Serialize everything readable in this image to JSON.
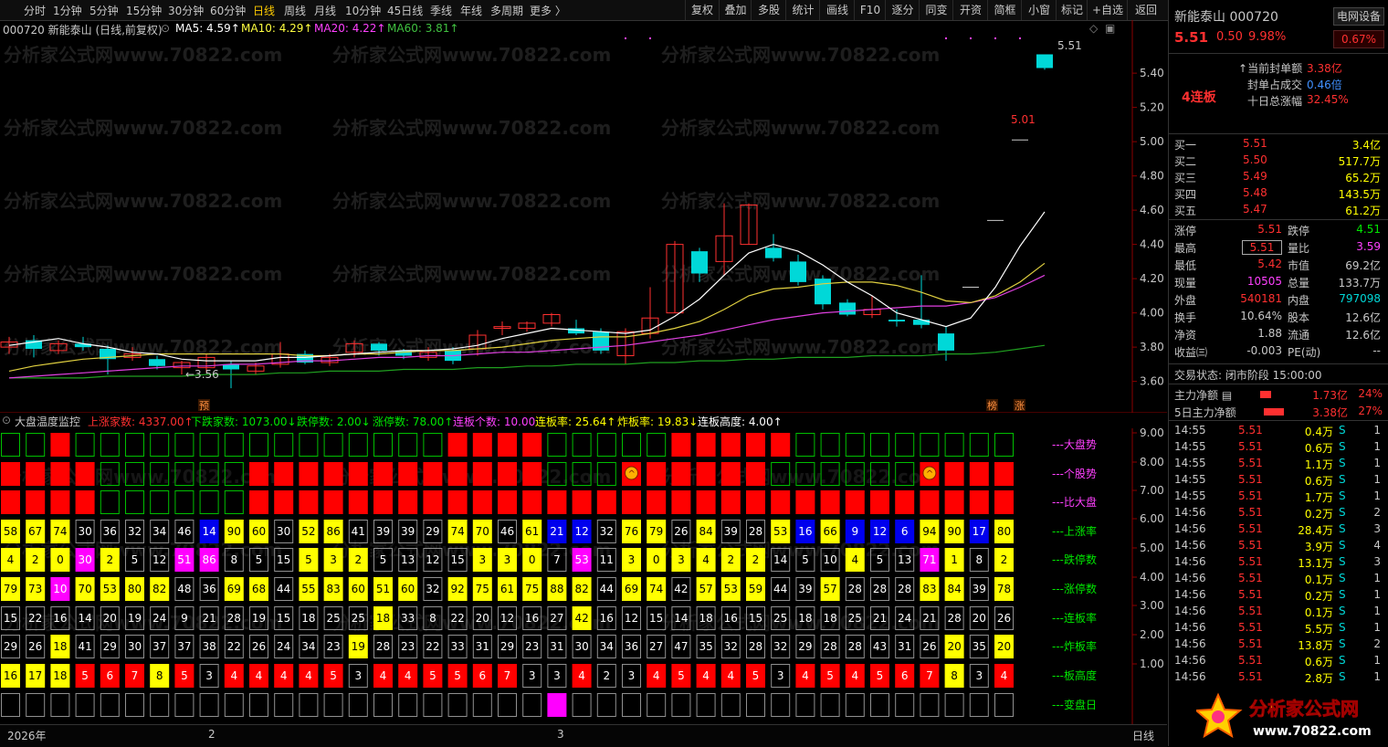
{
  "toolbar": {
    "periods": [
      "分时",
      "1分钟",
      "5分钟",
      "15分钟",
      "30分钟",
      "60分钟",
      "日线",
      "周线",
      "月线",
      "10分钟",
      "45日线",
      "季线",
      "年线",
      "多周期",
      "更多 〉"
    ],
    "active": "日线",
    "right_tools": [
      "复权",
      "叠加",
      "多股",
      "统计",
      "画线",
      "F10",
      "逐分",
      "同变",
      "开资",
      "简框",
      "小窗",
      "标记",
      "+自选",
      "返回"
    ]
  },
  "main_header": {
    "stock_label": "000720 新能泰山 (日线,前复权)",
    "ma5": "MA5: 4.59↑",
    "ma10": "MA10: 4.29↑",
    "ma20": "MA20: 4.22↑",
    "ma60": "MA60: 3.81↑"
  },
  "price_axis": [
    "5.40",
    "5.20",
    "5.00",
    "4.80",
    "4.60",
    "4.40",
    "4.20",
    "4.00",
    "3.80",
    "3.60"
  ],
  "annotations": {
    "high_label": "5.51",
    "mid_label": "5.01",
    "low_label": "3.56",
    "marker_yu": "预",
    "marker_bang": "榜",
    "marker_zhang": "涨"
  },
  "watermark": "分析家公式网www.70822.com",
  "sub_header": {
    "title": "大盘温度监控",
    "up": "上涨家数: 4337.00↑",
    "down": "下跌家数: 1073.00↓",
    "limit_down": "跌停数: 2.00↓",
    "limit_up": "涨停数: 78.00↑",
    "consec": "连板个数: 10.00",
    "consec_rate": "连板率: 25.64↑",
    "blow_rate": "炸板率: 19.83↓",
    "consec_height": "连板高度: 4.00↑"
  },
  "sub_axis": [
    "9.00",
    "8.00",
    "7.00",
    "6.00",
    "5.00",
    "4.00",
    "3.00",
    "2.00",
    "1.00"
  ],
  "row_labels": [
    "---大盘势",
    "---个股势",
    "---比大盘",
    "---上涨率",
    "---跌停数",
    "---涨停数",
    "---连板率",
    "---炸板率",
    "---板高度",
    "---变盘日"
  ],
  "grid": {
    "dapan": "GGRGGGGGGGGGGGGGGGRRRRGGGGGRRRRRGGGGGGGGG",
    "gegu": "RRRRGGGGGGRRRRRRRRRRRRGGGURRRRRGGGGGGURRR",
    "bidapan": "RRRRGGGGGGRRRRRRRRRRRRRRRRRRRRRRRRRRRRRRR",
    "shangzhang": {
      "v": [
        "58",
        "67",
        "74",
        "30",
        "36",
        "32",
        "34",
        "46",
        "14",
        "90",
        "60",
        "30",
        "52",
        "86",
        "41",
        "39",
        "39",
        "29",
        "74",
        "70",
        "46",
        "61",
        "21",
        "12",
        "32",
        "76",
        "79",
        "26",
        "84",
        "39",
        "28",
        "53",
        "16",
        "66",
        "9",
        "12",
        "6",
        "94",
        "90",
        "17",
        "80"
      ],
      "c": "YYYKKKKKBYYKYYKKKKYYKYBBKYYKYKKYBYBBBYYBY"
    },
    "dieting": {
      "v": [
        "4",
        "2",
        "0",
        "30",
        "2",
        "5",
        "12",
        "51",
        "86",
        "8",
        "5",
        "15",
        "5",
        "3",
        "2",
        "5",
        "13",
        "12",
        "15",
        "3",
        "3",
        "0",
        "7",
        "53",
        "11",
        "3",
        "0",
        "3",
        "4",
        "2",
        "2",
        "14",
        "5",
        "10",
        "4",
        "5",
        "13",
        "71",
        "1",
        "8",
        "2"
      ],
      "c": "YYYMYKKMMKKKYYYKKKKYYYKMKYYYYYYKKKYKKMYKY"
    },
    "zhangting": {
      "v": [
        "79",
        "73",
        "10",
        "70",
        "53",
        "80",
        "82",
        "48",
        "36",
        "69",
        "68",
        "44",
        "55",
        "83",
        "60",
        "51",
        "60",
        "32",
        "92",
        "75",
        "61",
        "75",
        "88",
        "82",
        "44",
        "69",
        "74",
        "42",
        "57",
        "53",
        "59",
        "44",
        "39",
        "57",
        "28",
        "28",
        "28",
        "83",
        "84",
        "39",
        "78"
      ],
      "c": "YYMYYYYKKYYKYYYYYKYYYYYYKYYKYYYKKYKKKYYKY"
    },
    "lianban": {
      "v": [
        "15",
        "22",
        "16",
        "14",
        "20",
        "19",
        "24",
        "9",
        "21",
        "28",
        "19",
        "15",
        "18",
        "25",
        "25",
        "18",
        "33",
        "8",
        "22",
        "20",
        "12",
        "16",
        "27",
        "42",
        "16",
        "12",
        "15",
        "14",
        "18",
        "16",
        "15",
        "25",
        "18",
        "18",
        "25",
        "21",
        "24",
        "21",
        "28",
        "20",
        "26"
      ],
      "c": "KKKKKKKKKKKKKKKYKKKKKKKYKKKKKKKKKKKKKKKKK"
    },
    "zhaban": {
      "v": [
        "29",
        "26",
        "18",
        "41",
        "29",
        "30",
        "37",
        "37",
        "38",
        "22",
        "26",
        "24",
        "34",
        "23",
        "19",
        "28",
        "23",
        "22",
        "33",
        "31",
        "29",
        "23",
        "31",
        "30",
        "34",
        "36",
        "27",
        "47",
        "35",
        "32",
        "28",
        "32",
        "29",
        "28",
        "28",
        "43",
        "31",
        "26",
        "20",
        "35",
        "20"
      ],
      "c": "KKYKKKKKKKKKKKYKKKKKKKKKKKKKKKKKKKKKKKYKY"
    },
    "banggao": {
      "v": [
        "16",
        "17",
        "18",
        "5",
        "6",
        "7",
        "8",
        "5",
        "3",
        "4",
        "4",
        "4",
        "4",
        "5",
        "3",
        "4",
        "4",
        "5",
        "5",
        "6",
        "7",
        "3",
        "3",
        "4",
        "2",
        "3",
        "4",
        "5",
        "4",
        "4",
        "5",
        "3",
        "4",
        "5",
        "4",
        "5",
        "6",
        "7",
        "8",
        "3",
        "4"
      ],
      "c": "YYYRRRYRKRRRRRKRRRRRRKKRKKRRRRRKRRRRRRYKR"
    },
    "biandan": "KKKKKKKKKKKKKKKKKKKKKKMKKKKKKKKKKKKKKKKKK"
  },
  "bottom": {
    "year": "2026年",
    "month2": "2",
    "month3": "3",
    "period": "日线"
  },
  "quote": {
    "name": "新能泰山",
    "code": "000720",
    "device": "电网设备",
    "price": "5.51",
    "chg": "0.50",
    "pct": "9.98%",
    "sector_pct": "0.67%",
    "streak": "4连板",
    "seal_amount_label": "当前封单额",
    "seal_amount": "3.38亿",
    "seal_ratio_label": "封单占成交",
    "seal_ratio": "0.46倍",
    "ten_day_label": "十日总涨幅",
    "ten_day": "32.45%"
  },
  "bids": [
    {
      "label": "买一",
      "price": "5.51",
      "vol": "3.4亿"
    },
    {
      "label": "买二",
      "price": "5.50",
      "vol": "517.7万"
    },
    {
      "label": "买三",
      "price": "5.49",
      "vol": "65.2万"
    },
    {
      "label": "买四",
      "price": "5.48",
      "vol": "143.5万"
    },
    {
      "label": "买五",
      "price": "5.47",
      "vol": "61.2万"
    }
  ],
  "stats": [
    [
      "涨停",
      "5.51",
      "跌停",
      "4.51"
    ],
    [
      "最高",
      "5.51",
      "量比",
      "3.59"
    ],
    [
      "最低",
      "5.42",
      "市值",
      "69.2亿"
    ],
    [
      "现量",
      "10505",
      "总量",
      "133.7万"
    ],
    [
      "外盘",
      "540181",
      "内盘",
      "797098"
    ],
    [
      "换手",
      "10.64%",
      "股本",
      "12.6亿"
    ],
    [
      "净资",
      "1.88",
      "流通",
      "12.6亿"
    ],
    [
      "收益㈢",
      "-0.003",
      "PE(动)",
      "--"
    ]
  ],
  "trade_state": "交易状态: 闭市阶段 15:00:00",
  "flows": [
    {
      "label": "主力净额",
      "val": "1.73亿",
      "pct": "24%"
    },
    {
      "label": "5日主力净额",
      "val": "3.38亿",
      "pct": "27%"
    }
  ],
  "ticks": [
    [
      "14:55",
      "5.51",
      "0.4万",
      "S",
      "1"
    ],
    [
      "14:55",
      "5.51",
      "0.6万",
      "S",
      "1"
    ],
    [
      "14:55",
      "5.51",
      "1.1万",
      "S",
      "1"
    ],
    [
      "14:55",
      "5.51",
      "0.6万",
      "S",
      "1"
    ],
    [
      "14:55",
      "5.51",
      "1.7万",
      "S",
      "1"
    ],
    [
      "14:56",
      "5.51",
      "0.2万",
      "S",
      "2"
    ],
    [
      "14:56",
      "5.51",
      "28.4万",
      "S",
      "3"
    ],
    [
      "14:56",
      "5.51",
      "3.9万",
      "S",
      "4"
    ],
    [
      "14:56",
      "5.51",
      "13.1万",
      "S",
      "3"
    ],
    [
      "14:56",
      "5.51",
      "0.1万",
      "S",
      "1"
    ],
    [
      "14:56",
      "5.51",
      "0.2万",
      "S",
      "1"
    ],
    [
      "14:56",
      "5.51",
      "0.1万",
      "S",
      "1"
    ],
    [
      "14:56",
      "5.51",
      "5.5万",
      "S",
      "1"
    ],
    [
      "14:56",
      "5.51",
      "13.8万",
      "S",
      "2"
    ],
    [
      "14:56",
      "5.51",
      "0.6万",
      "S",
      "1"
    ],
    [
      "14:56",
      "5.51",
      "2.8万",
      "S",
      "1"
    ]
  ],
  "logo": {
    "text": "分析家公式网",
    "url": "www.70822.com"
  },
  "colors": {
    "up": "#ff3030",
    "down": "#00d8d8",
    "grid_green": "#00c000",
    "cell_red": "#ff0000",
    "cell_yellow": "#ffff00",
    "cell_magenta": "#ff00ff",
    "cell_blue": "#0000ee"
  },
  "candles": [
    {
      "o": 3.8,
      "c": 3.83,
      "h": 3.86,
      "l": 3.76
    },
    {
      "o": 3.84,
      "c": 3.79,
      "h": 3.87,
      "l": 3.74
    },
    {
      "o": 3.78,
      "c": 3.82,
      "h": 3.84,
      "l": 3.76
    },
    {
      "o": 3.82,
      "c": 3.8,
      "h": 3.86,
      "l": 3.78
    },
    {
      "o": 3.79,
      "c": 3.73,
      "h": 3.81,
      "l": 3.64
    },
    {
      "o": 3.74,
      "c": 3.76,
      "h": 3.8,
      "l": 3.72
    },
    {
      "o": 3.73,
      "c": 3.69,
      "h": 3.75,
      "l": 3.67
    },
    {
      "o": 3.68,
      "c": 3.71,
      "h": 3.72,
      "l": 3.64
    },
    {
      "o": 3.68,
      "c": 3.74,
      "h": 3.76,
      "l": 3.65
    },
    {
      "o": 3.7,
      "c": 3.67,
      "h": 3.72,
      "l": 3.56
    },
    {
      "o": 3.66,
      "c": 3.69,
      "h": 3.71,
      "l": 3.64
    },
    {
      "o": 3.7,
      "c": 3.76,
      "h": 3.83,
      "l": 3.68
    },
    {
      "o": 3.76,
      "c": 3.71,
      "h": 3.78,
      "l": 3.7
    },
    {
      "o": 3.71,
      "c": 3.74,
      "h": 3.76,
      "l": 3.69
    },
    {
      "o": 3.77,
      "c": 3.82,
      "h": 3.84,
      "l": 3.74
    },
    {
      "o": 3.82,
      "c": 3.78,
      "h": 3.83,
      "l": 3.75
    },
    {
      "o": 3.78,
      "c": 3.75,
      "h": 3.79,
      "l": 3.73
    },
    {
      "o": 3.74,
      "c": 3.77,
      "h": 3.8,
      "l": 3.72
    },
    {
      "o": 3.78,
      "c": 3.72,
      "h": 3.8,
      "l": 3.7
    },
    {
      "o": 3.79,
      "c": 3.87,
      "h": 3.9,
      "l": 3.75
    },
    {
      "o": 3.91,
      "c": 3.92,
      "h": 3.95,
      "l": 3.87
    },
    {
      "o": 3.91,
      "c": 3.94,
      "h": 3.95,
      "l": 3.89
    },
    {
      "o": 3.94,
      "c": 3.99,
      "h": 4.0,
      "l": 3.92
    },
    {
      "o": 3.91,
      "c": 3.88,
      "h": 3.96,
      "l": 3.87
    },
    {
      "o": 3.89,
      "c": 3.78,
      "h": 3.91,
      "l": 3.76
    },
    {
      "o": 3.75,
      "c": 3.89,
      "h": 3.91,
      "l": 3.7
    },
    {
      "o": 3.88,
      "c": 3.97,
      "h": 4.15,
      "l": 3.85
    },
    {
      "o": 4.0,
      "c": 4.4,
      "h": 4.42,
      "l": 4.0
    },
    {
      "o": 4.36,
      "c": 4.23,
      "h": 4.38,
      "l": 4.18
    },
    {
      "o": 4.3,
      "c": 4.45,
      "h": 4.64,
      "l": 4.22
    },
    {
      "o": 4.4,
      "c": 4.63,
      "h": 4.64,
      "l": 4.4
    },
    {
      "o": 4.38,
      "c": 4.32,
      "h": 4.46,
      "l": 4.3
    },
    {
      "o": 4.3,
      "c": 4.18,
      "h": 4.34,
      "l": 4.16
    },
    {
      "o": 4.2,
      "c": 4.05,
      "h": 4.22,
      "l": 4.02
    },
    {
      "o": 4.06,
      "c": 3.99,
      "h": 4.08,
      "l": 3.98
    },
    {
      "o": 3.99,
      "c": 4.02,
      "h": 4.1,
      "l": 3.97
    },
    {
      "o": 3.96,
      "c": 3.95,
      "h": 4.02,
      "l": 3.92
    },
    {
      "o": 3.96,
      "c": 3.93,
      "h": 4.22,
      "l": 3.91
    },
    {
      "o": 3.88,
      "c": 3.78,
      "h": 3.92,
      "l": 3.72
    },
    {
      "o": 4.15,
      "c": 4.15,
      "h": 4.15,
      "l": 4.15
    },
    {
      "o": 4.54,
      "c": 4.54,
      "h": 4.54,
      "l": 4.54
    },
    {
      "o": 5.01,
      "c": 5.01,
      "h": 5.01,
      "l": 5.01
    },
    {
      "o": 5.51,
      "c": 5.43,
      "h": 5.51,
      "l": 5.42
    }
  ],
  "ma5_points": [
    3.81,
    3.83,
    3.85,
    3.82,
    3.8,
    3.77,
    3.76,
    3.73,
    3.72,
    3.72,
    3.72,
    3.74,
    3.74,
    3.75,
    3.76,
    3.77,
    3.78,
    3.78,
    3.79,
    3.81,
    3.85,
    3.88,
    3.91,
    3.9,
    3.89,
    3.88,
    3.9,
    3.98,
    4.08,
    4.22,
    4.35,
    4.4,
    4.36,
    4.28,
    4.18,
    4.1,
    4.0,
    3.96,
    3.92,
    3.97,
    4.15,
    4.39,
    4.59
  ],
  "ma10_points": [
    3.66,
    3.69,
    3.71,
    3.73,
    3.74,
    3.75,
    3.76,
    3.76,
    3.76,
    3.76,
    3.76,
    3.76,
    3.75,
    3.75,
    3.76,
    3.76,
    3.77,
    3.78,
    3.78,
    3.79,
    3.8,
    3.82,
    3.84,
    3.85,
    3.86,
    3.86,
    3.88,
    3.91,
    3.95,
    4.02,
    4.1,
    4.14,
    4.15,
    4.17,
    4.18,
    4.18,
    4.16,
    4.12,
    4.07,
    4.06,
    4.1,
    4.18,
    4.29
  ],
  "ma20_points": [
    3.62,
    3.63,
    3.64,
    3.65,
    3.66,
    3.67,
    3.68,
    3.69,
    3.69,
    3.7,
    3.7,
    3.71,
    3.72,
    3.72,
    3.73,
    3.74,
    3.74,
    3.75,
    3.75,
    3.76,
    3.77,
    3.77,
    3.78,
    3.79,
    3.8,
    3.81,
    3.83,
    3.85,
    3.87,
    3.9,
    3.93,
    3.96,
    3.98,
    4.0,
    4.01,
    4.02,
    4.03,
    4.04,
    4.04,
    4.06,
    4.09,
    4.15,
    4.22
  ],
  "ma60_points": [
    3.62,
    3.62,
    3.62,
    3.62,
    3.63,
    3.63,
    3.63,
    3.63,
    3.64,
    3.64,
    3.64,
    3.65,
    3.65,
    3.66,
    3.66,
    3.66,
    3.67,
    3.67,
    3.67,
    3.68,
    3.68,
    3.69,
    3.69,
    3.7,
    3.7,
    3.7,
    3.71,
    3.71,
    3.72,
    3.72,
    3.73,
    3.73,
    3.74,
    3.74,
    3.74,
    3.75,
    3.75,
    3.75,
    3.76,
    3.76,
    3.77,
    3.79,
    3.81
  ]
}
